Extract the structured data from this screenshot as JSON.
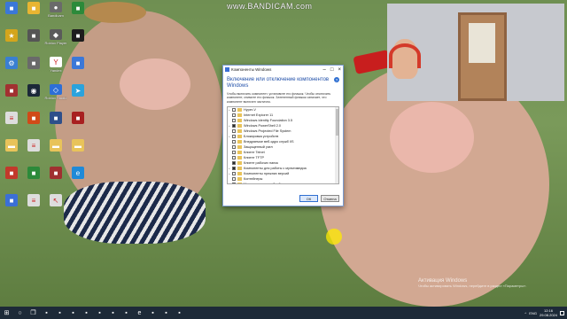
{
  "watermark": "www.BANDICAM.com",
  "desktop_icons": [
    {
      "label": "",
      "icon": "app-icon",
      "color": "#3b78d8"
    },
    {
      "label": "",
      "icon": "app-icon",
      "color": "#e8b532"
    },
    {
      "label": "Bandicam",
      "icon": "bandicam-icon",
      "color": "#6a6a6a"
    },
    {
      "label": "",
      "icon": "app-icon",
      "color": "#2c8a3a"
    },
    {
      "label": "",
      "icon": "star-icon",
      "color": "#d4a51c"
    },
    {
      "label": "",
      "icon": "app-icon",
      "color": "#555555"
    },
    {
      "label": "Roblox Player",
      "icon": "roblox-icon",
      "color": "#5a5a5a"
    },
    {
      "label": "",
      "icon": "app-icon",
      "color": "#1d1d1d"
    },
    {
      "label": "",
      "icon": "gear-icon",
      "color": "#3a7fd1"
    },
    {
      "label": "",
      "icon": "app-icon",
      "color": "#6a6a6a"
    },
    {
      "label": "Yandex",
      "icon": "yandex-icon",
      "color": "#ffffff"
    },
    {
      "label": "",
      "icon": "app-icon",
      "color": "#3b78d8"
    },
    {
      "label": "",
      "icon": "app-icon",
      "color": "#a23131"
    },
    {
      "label": "",
      "icon": "steam-icon",
      "color": "#1b2838"
    },
    {
      "label": "Roblox Studio",
      "icon": "roblox-studio-icon",
      "color": "#2d6fd6"
    },
    {
      "label": "",
      "icon": "telegram-icon",
      "color": "#2aa3dd"
    },
    {
      "label": "",
      "icon": "document-icon",
      "color": "#dddddd"
    },
    {
      "label": "",
      "icon": "app-icon",
      "color": "#d04a18"
    },
    {
      "label": "",
      "icon": "app-icon",
      "color": "#2e4f8a"
    },
    {
      "label": "",
      "icon": "app-icon",
      "color": "#a82020"
    },
    {
      "label": "",
      "icon": "folder-icon",
      "color": "#e8c35a"
    },
    {
      "label": "",
      "icon": "document-icon",
      "color": "#dddddd"
    },
    {
      "label": "",
      "icon": "folder-icon",
      "color": "#e8c35a"
    },
    {
      "label": "",
      "icon": "folder-icon",
      "color": "#e8c35a"
    },
    {
      "label": "",
      "icon": "app-icon",
      "color": "#c2392b"
    },
    {
      "label": "",
      "icon": "app-icon",
      "color": "#2c8a3a"
    },
    {
      "label": "",
      "icon": "app-icon",
      "color": "#a03030"
    },
    {
      "label": "",
      "icon": "edge-icon",
      "color": "#1f8ad8"
    },
    {
      "label": "",
      "icon": "app-icon",
      "color": "#3b6fd6"
    },
    {
      "label": "",
      "icon": "document-icon",
      "color": "#dddddd"
    },
    {
      "label": "",
      "icon": "cursor-icon",
      "color": "#dddddd"
    }
  ],
  "dialog": {
    "title": "Компоненты Windows",
    "heading": "Включение или отключение компонентов Windows",
    "description": "Чтобы включить компонент, установите его флажок. Чтобы отключить компонент, снимите его флажок. Затененный флажок означает, что компонент включен частично.",
    "features": [
      {
        "label": "Hyper-V",
        "expand": "+",
        "state": "off",
        "folder": true
      },
      {
        "label": "Internet Explorer 11",
        "expand": "",
        "state": "off",
        "folder": true
      },
      {
        "label": "Windows Identity Foundation 3.5",
        "expand": "",
        "state": "off",
        "folder": true
      },
      {
        "label": "Windows PowerShell 2.0",
        "expand": "+",
        "state": "on",
        "folder": true
      },
      {
        "label": "Windows Projected File System",
        "expand": "",
        "state": "off",
        "folder": true
      },
      {
        "label": "Блокировка устройств",
        "expand": "+",
        "state": "off",
        "folder": true
      },
      {
        "label": "Внедряемое веб-ядро служб IIS",
        "expand": "",
        "state": "off",
        "folder": true
      },
      {
        "label": "Защищенный узел",
        "expand": "",
        "state": "off",
        "folder": true
      },
      {
        "label": "Клиент Telnet",
        "expand": "",
        "state": "off",
        "folder": true
      },
      {
        "label": "Клиент TFTP",
        "expand": "",
        "state": "off",
        "folder": true
      },
      {
        "label": "Клиент рабочих папок",
        "expand": "",
        "state": "on",
        "folder": true
      },
      {
        "label": "Компоненты для работы с мультимедиа",
        "expand": "+",
        "state": "on",
        "folder": true
      },
      {
        "label": "Компоненты прежних версий",
        "expand": "+",
        "state": "off",
        "folder": true
      },
      {
        "label": "Контейнеры",
        "expand": "",
        "state": "off",
        "folder": true
      },
      {
        "label": "Мост для центра обработки данных",
        "expand": "",
        "state": "off",
        "folder": true
      }
    ],
    "ok_label": "ОК",
    "cancel_label": "Отмена",
    "help_icon": "?"
  },
  "activation": {
    "line1": "Активация Windows",
    "line2": "Чтобы активировать Windows, перейдите в раздел «Параметры»."
  },
  "taskbar": {
    "apps": [
      "start-icon",
      "search-icon",
      "task-view-icon",
      "app-icon",
      "app-icon",
      "app-icon",
      "app-icon",
      "app-icon",
      "app-icon",
      "app-icon",
      "edge-icon",
      "app-icon",
      "app-icon",
      "app-icon"
    ],
    "tray": {
      "lang": "ENG",
      "time": "12:16",
      "date": "29.08.2024"
    }
  }
}
